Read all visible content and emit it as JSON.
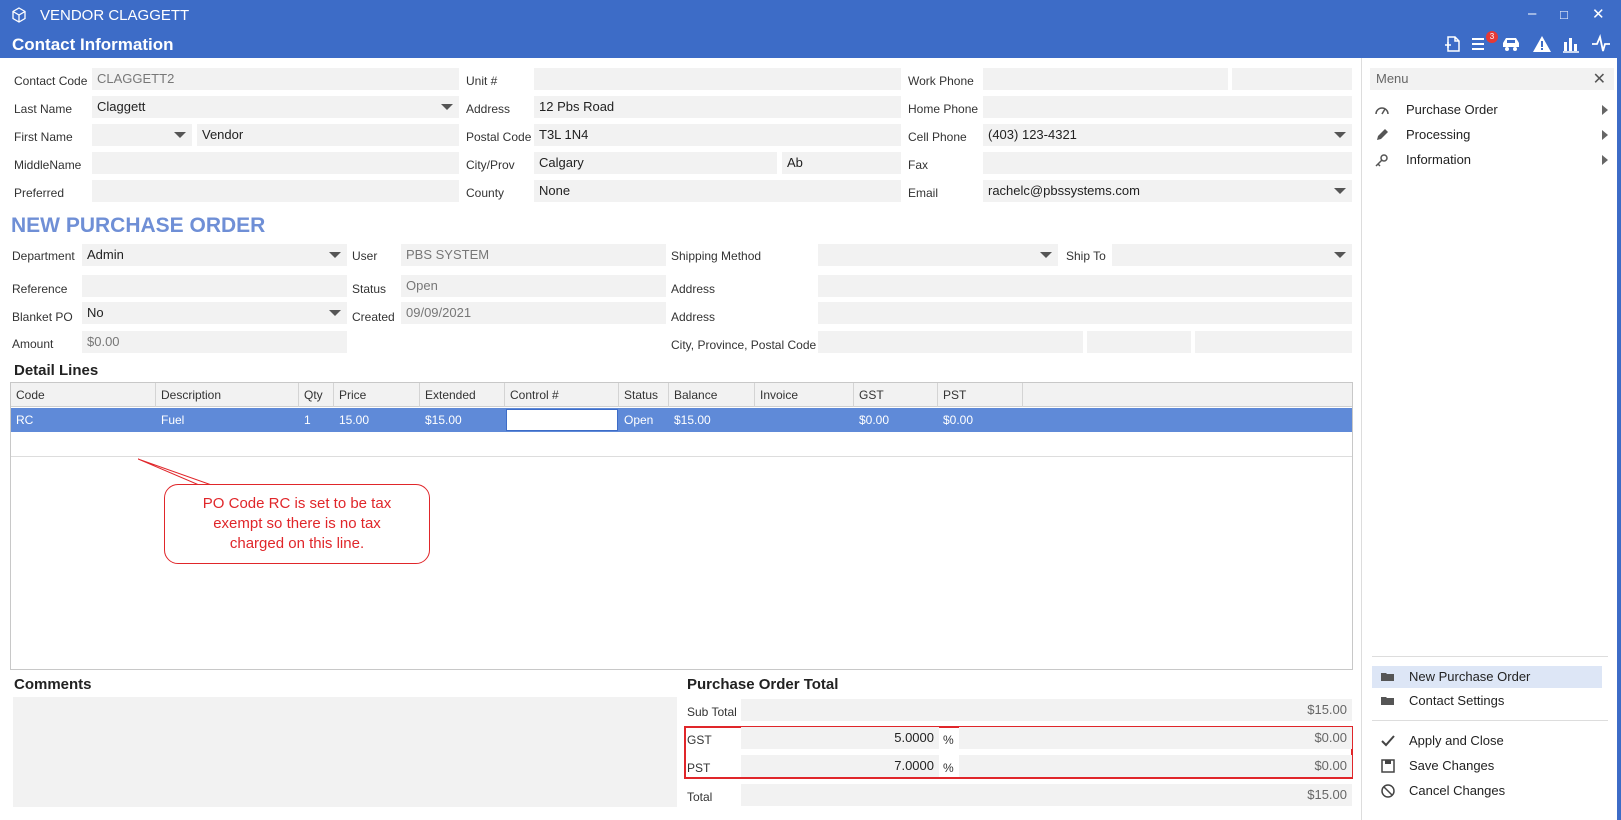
{
  "window": {
    "title": "VENDOR CLAGGETT",
    "header": "Contact Information",
    "badge": "3"
  },
  "contact": {
    "code_label": "Contact Code",
    "code": "CLAGGETT2",
    "last_label": "Last Name",
    "last": "Claggett",
    "first_label": "First Name",
    "first": "Vendor",
    "middle_label": "MiddleName",
    "middle": "",
    "preferred_label": "Preferred",
    "preferred": "",
    "unit_label": "Unit #",
    "unit": "",
    "address_label": "Address",
    "address": "12 Pbs Road",
    "postal_label": "Postal Code",
    "postal": "T3L 1N4",
    "city_label": "City/Prov",
    "city": "Calgary",
    "prov": "Ab",
    "county_label": "County",
    "county": "None",
    "work_label": "Work Phone",
    "work": "",
    "home_label": "Home Phone",
    "home": "",
    "cell_label": "Cell Phone",
    "cell": "(403) 123-4321",
    "fax_label": "Fax",
    "fax": "",
    "email_label": "Email",
    "email": "rachelc@pbssystems.com"
  },
  "po": {
    "title": "NEW PURCHASE ORDER",
    "dept_label": "Department",
    "dept": "Admin",
    "ref_label": "Reference",
    "ref": "",
    "blanket_label": "Blanket PO",
    "blanket": "No",
    "amount_label": "Amount",
    "amount": "$0.00",
    "user_label": "User",
    "user": "PBS SYSTEM",
    "status_label": "Status",
    "status": "Open",
    "created_label": "Created",
    "created": "09/09/2021",
    "ship_method_label": "Shipping Method",
    "ship_method": "",
    "ship_to_label": "Ship To",
    "ship_to": "",
    "address1_label": "Address",
    "address2_label": "Address",
    "cpp_label": "City, Province, Postal Code"
  },
  "detail": {
    "title": "Detail Lines",
    "columns": [
      "Code",
      "Description",
      "Qty",
      "Price",
      "Extended",
      "Control #",
      "Status",
      "Balance",
      "Invoice",
      "GST",
      "PST"
    ],
    "row": [
      "RC",
      "Fuel",
      "1",
      "15.00",
      "$15.00",
      "",
      "Open",
      "$15.00",
      "",
      "$0.00",
      "$0.00"
    ]
  },
  "callout": {
    "line1": "PO Code RC is set to be tax",
    "line2": "exempt so there is no tax",
    "line3": "charged on this line."
  },
  "comments": {
    "title": "Comments"
  },
  "totals": {
    "title": "Purchase Order Total",
    "subtotal_label": "Sub Total",
    "subtotal": "$15.00",
    "gst_label": "GST",
    "gst_rate": "5.0000",
    "gst_pct": "%",
    "gst_amount": "$0.00",
    "pst_label": "PST",
    "pst_rate": "7.0000",
    "pst_pct": "%",
    "pst_amount": "$0.00",
    "total_label": "Total",
    "total": "$15.00"
  },
  "menu": {
    "title": "Menu",
    "items": [
      "Purchase Order",
      "Processing",
      "Information"
    ],
    "actions": [
      "New Purchase Order",
      "Contact Settings",
      "Apply and Close",
      "Save Changes",
      "Cancel Changes"
    ]
  }
}
